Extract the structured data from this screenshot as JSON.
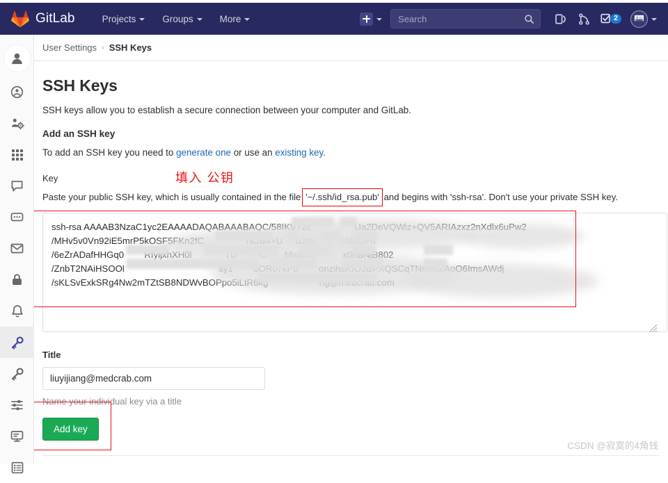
{
  "navbar": {
    "brand": "GitLab",
    "logo_icon": "gitlab-fox-logo",
    "links": [
      {
        "label": "Projects",
        "icon": "chevron-down-icon"
      },
      {
        "label": "Groups",
        "icon": "chevron-down-icon"
      },
      {
        "label": "More",
        "icon": "chevron-down-icon"
      }
    ],
    "create_new": {
      "icon": "plus-square-icon",
      "caret": "chevron-down-icon"
    },
    "search": {
      "placeholder": "Search",
      "value": "",
      "icon": "search-icon"
    },
    "icons": [
      {
        "name": "issues-icon",
        "title": "Issues"
      },
      {
        "name": "merge-requests-icon",
        "title": "Merge requests"
      }
    ],
    "todos": {
      "icon": "todos-checkbox-icon",
      "count": "2"
    },
    "user": {
      "icon": "user-avatar-icon",
      "caret": "chevron-down-icon"
    },
    "colors": {
      "background": "#292961",
      "badge": "#1f78d1",
      "search_bg": "#3d3d73"
    }
  },
  "sidebar": {
    "items": [
      {
        "label": "Profile avatar",
        "icon": "user-avatar-icon",
        "active": false
      },
      {
        "label": "Profile",
        "icon": "profile-circle-icon",
        "active": false
      },
      {
        "label": "Account",
        "icon": "account-gear-icon",
        "active": false
      },
      {
        "label": "Applications",
        "icon": "grid-apps-icon",
        "active": false
      },
      {
        "label": "Chat",
        "icon": "chat-bubble-icon",
        "active": false
      },
      {
        "label": "Access Tokens",
        "icon": "comment-dots-icon",
        "active": false
      },
      {
        "label": "Emails",
        "icon": "envelope-icon",
        "active": false
      },
      {
        "label": "Password",
        "icon": "lock-icon",
        "active": false
      },
      {
        "label": "Notifications",
        "icon": "bell-icon",
        "active": false
      },
      {
        "label": "SSH Keys",
        "icon": "key-icon",
        "active": true
      },
      {
        "label": "GPG Keys",
        "icon": "key-icon",
        "active": false
      },
      {
        "label": "Preferences",
        "icon": "sliders-icon",
        "active": false
      },
      {
        "label": "Active Sessions",
        "icon": "monitor-icon",
        "active": false
      },
      {
        "label": "Authentication Log",
        "icon": "list-log-icon",
        "active": false
      }
    ],
    "active_color": "#3f3fa0"
  },
  "breadcrumb": {
    "parent": "User Settings",
    "separator": "›",
    "current": "SSH Keys"
  },
  "main": {
    "title": "SSH Keys",
    "intro": "SSH keys allow you to establish a secure connection between your computer and GitLab.",
    "section_title": "Add an SSH key",
    "add_line_prefix": "To add an SSH key you need to ",
    "add_line_link1": "generate one",
    "add_line_middle": " or use an ",
    "add_line_link2": "existing key",
    "add_line_suffix": ".",
    "key_label": "Key",
    "paste_hint_prefix": "Paste your public SSH key, which is usually contained in the file ",
    "paste_hint_file": "'~/.ssh/id_rsa.pub'",
    "paste_hint_suffix": " and begins with 'ssh-rsa'. Don't use your private SSH key.",
    "key_value": "ssh-rsa AAAAB3NzaC1yc2EAAAADAQABAAABAQC/58IKV72c                 Ua2DeVQWiz+QV5ARIAzxz2nXdlx6uPw2\n/MHv5v0Vn92iE5mrP5kOSF5FKn2fC                7kJw4+U     uJmc         c9MGFn\n/6eZrADafHHGq0        RfyljxhXH0l             TU         C       MvanJr           x0hBNjB802\n/ZnbT2NAiHSOOl                                     sy1        uORo7kPb        onzihsKfO3BPXQSCqTNm6G/AoO6ImsAWdj\n/sKLSvExkSRg4Nw2mTZtSB8NDWvBOPpo5iLtR6kg                    ng@medcrab.com",
    "title_label": "Title",
    "title_value": "liuyijiang@medcrab.com",
    "title_hint": "Name your individual key via a title",
    "add_key_button": "Add key"
  },
  "annotations": {
    "chinese_note": "填入 公钥",
    "color": "#f01414"
  },
  "watermark": "CSDN @寂寞的4角钱"
}
